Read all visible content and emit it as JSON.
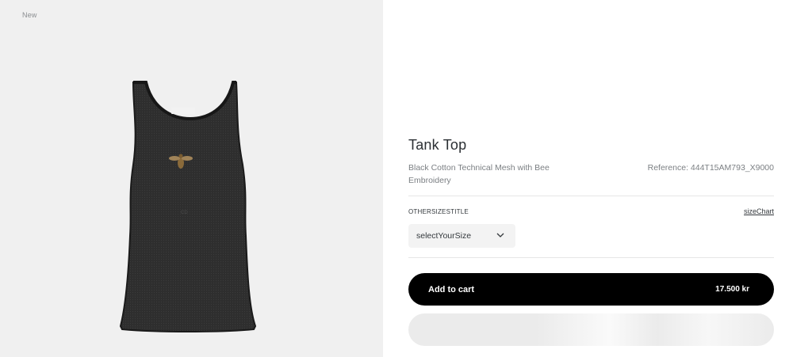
{
  "product_image": {
    "badge": "New",
    "alt": "Tank Top"
  },
  "product": {
    "title": "Tank Top",
    "description": "Black Cotton Technical Mesh with Bee Embroidery",
    "reference": "Reference: 444T15AM793_X9000"
  },
  "size": {
    "title": "OTHERSIZESTITLE",
    "chart_link": "sizeChart",
    "select_value": "selectYourSize"
  },
  "cart": {
    "add_label": "Add to cart",
    "price": "17.500 kr"
  },
  "colors": {
    "image_background": "#f0f0f0",
    "garment": "#2b2b2b",
    "button_primary": "#000000",
    "button_text": "#ffffff",
    "muted_text": "#7b7f83"
  },
  "icons": {
    "size_dropdown": "chevron-down-icon"
  }
}
